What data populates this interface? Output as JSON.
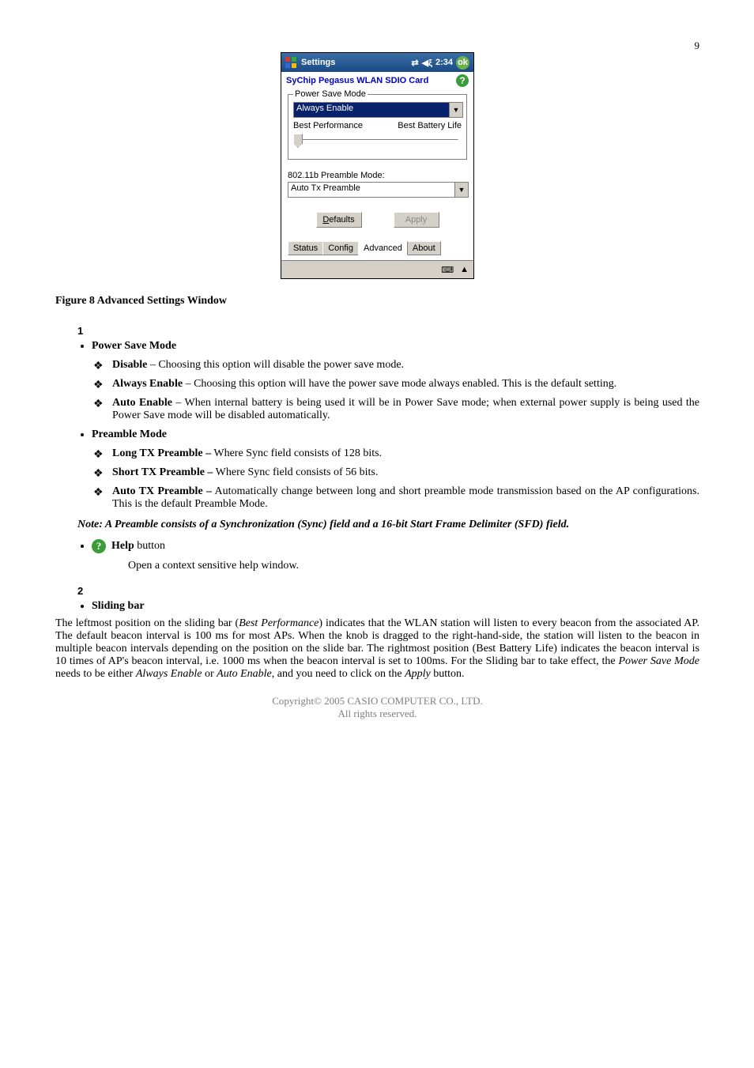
{
  "page_number": "9",
  "screenshot": {
    "titlebar": {
      "title": "Settings",
      "time": "2:34",
      "ok": "ok"
    },
    "app_title": "SyChip Pegasus WLAN SDIO Card",
    "psm": {
      "legend": "Power Save Mode",
      "selected": "Always Enable",
      "left_label": "Best Performance",
      "right_label": "Best Battery Life"
    },
    "preamble": {
      "label": "802.11b Preamble Mode:",
      "selected": "Auto Tx Preamble"
    },
    "buttons": {
      "defaults": "Defaults",
      "apply": "Apply"
    },
    "tabs": [
      "Status",
      "Config",
      "Advanced",
      "About"
    ]
  },
  "figure_caption": "Figure 8 Advanced Settings Window",
  "sec1": {
    "num": "1",
    "psm_heading": "Power Save Mode",
    "disable_label": "Disable",
    "disable_text": " – Choosing this option will disable the power save mode.",
    "always_label": "Always Enable",
    "always_text": " – Choosing this option will have the power save mode always enabled. This is the default setting.",
    "auto_label": "Auto Enable",
    "auto_text": " – When internal battery is being used it will be in Power Save mode; when external power supply is being used the Power Save mode will be disabled automatically.",
    "preamble_heading": "Preamble Mode",
    "long_label": "Long TX Preamble –",
    "long_text": " Where Sync field consists of 128 bits.",
    "short_label": "Short TX Preamble –",
    "short_text": " Where Sync field consists of 56 bits.",
    "autotx_label": "Auto TX Preamble –",
    "autotx_text": " Automatically change between long and short preamble mode transmission based on the AP configurations. This is the default Preamble Mode.",
    "note": "Note: A Preamble consists of a Synchronization (Sync) field and a 16-bit Start Frame Delimiter (SFD) field.",
    "help_label": "Help",
    "help_suffix": " button",
    "help_desc": "Open a context sensitive help window."
  },
  "sec2": {
    "num": "2",
    "heading": "Sliding bar",
    "para_a": "The leftmost position on the sliding bar (",
    "bp": "Best Performance",
    "para_b": ") indicates that the WLAN station will listen to every beacon from the associated AP.   The default beacon interval is 100 ms for most APs. When the knob is dragged to the right-hand-side, the station will listen to the beacon in multiple beacon intervals depending on the position on the slide bar.   The rightmost position (Best Battery Life) indicates the beacon interval is 10 times of AP's beacon interval, i.e. 1000 ms when the beacon interval is set to 100ms. For the Sliding bar to take effect, the ",
    "psm_i": "Power Save Mode",
    "para_c": " needs to be either ",
    "ae_i": "Always Enable",
    "para_d": " or ",
    "aue_i": "Auto Enable",
    "para_e": ", and you need to click on the ",
    "apply_i": "Apply",
    "para_f": " button."
  },
  "footer": {
    "l1": "Copyright© 2005 CASIO COMPUTER CO., LTD.",
    "l2": "All rights reserved."
  }
}
